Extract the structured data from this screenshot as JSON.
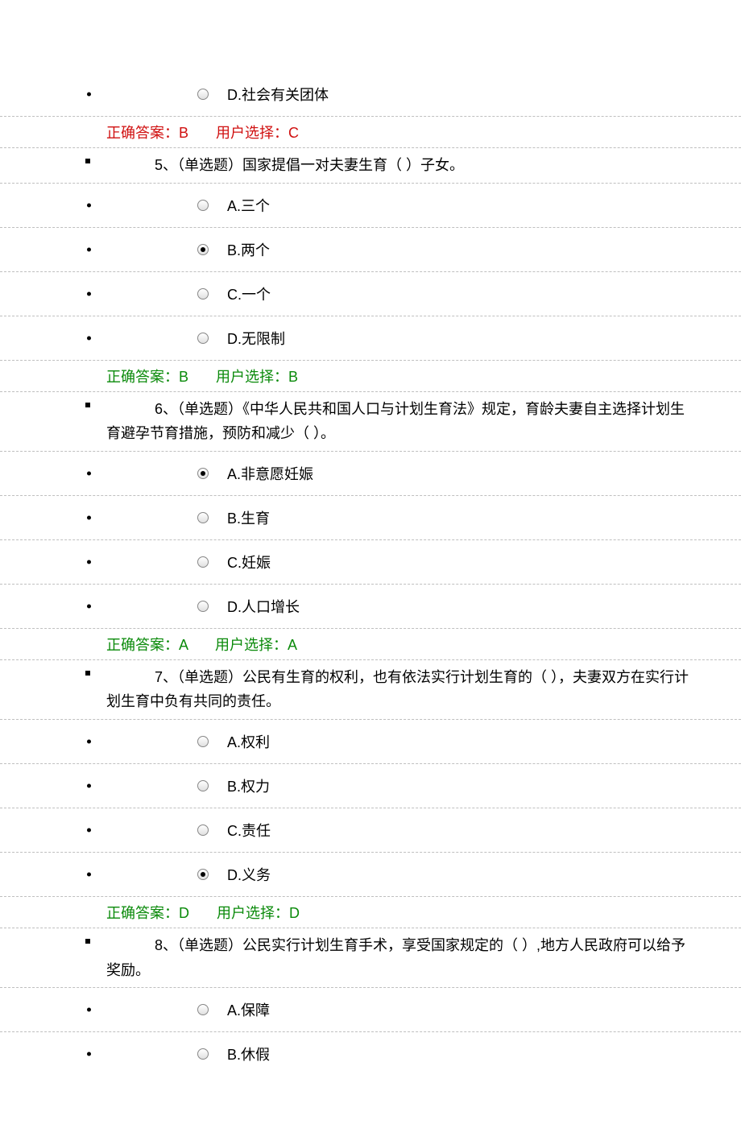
{
  "labels": {
    "correct_prefix": "正确答案：",
    "user_prefix": "用户选择："
  },
  "q4": {
    "optD": "D.社会有关团体",
    "correct": "B",
    "user": "C",
    "status": "wrong"
  },
  "q5": {
    "num": "5、",
    "type": "（单选题）",
    "text": "国家提倡一对夫妻生育（ ）子女。",
    "options": {
      "A": "A.三个",
      "B": "B.两个",
      "C": "C.一个",
      "D": "D.无限制"
    },
    "selected": "B",
    "correct": "B",
    "user": "B",
    "status": "right"
  },
  "q6": {
    "num": "6、",
    "type": "（单选题）",
    "text": "《中华人民共和国人口与计划生育法》规定，育龄夫妻自主选择计划生育避孕节育措施，预防和减少（ ）。",
    "options": {
      "A": "A.非意愿妊娠",
      "B": "B.生育",
      "C": "C.妊娠",
      "D": "D.人口增长"
    },
    "selected": "A",
    "correct": "A",
    "user": "A",
    "status": "right"
  },
  "q7": {
    "num": "7、",
    "type": "（单选题）",
    "text": "公民有生育的权利，也有依法实行计划生育的（ ），夫妻双方在实行计划生育中负有共同的责任。",
    "options": {
      "A": "A.权利",
      "B": "B.权力",
      "C": "C.责任",
      "D": "D.义务"
    },
    "selected": "D",
    "correct": "D",
    "user": "D",
    "status": "right"
  },
  "q8": {
    "num": "8、",
    "type": "（单选题）",
    "text": "公民实行计划生育手术，享受国家规定的（ ）,地方人民政府可以给予奖励。",
    "options": {
      "A": "A.保障",
      "B": "B.休假"
    },
    "selected": null
  }
}
